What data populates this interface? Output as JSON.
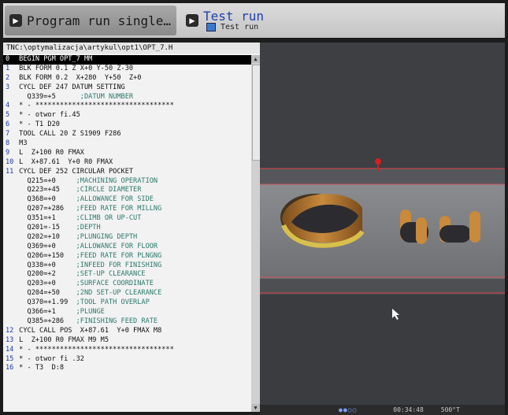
{
  "top_bar": {
    "left_tab_label": "Program run single…",
    "right_tab_title": "Test run",
    "right_tab_subtitle": "Test run"
  },
  "program": {
    "path": "TNC:\\optymalizacja\\artykul\\opt1\\OPT_7.H",
    "lines": [
      {
        "n": "0",
        "text": " BEGIN PGM OPT_7 MM",
        "active": true
      },
      {
        "n": "1",
        "text": " BLK FORM 0.1 Z X+0 Y-50 Z-30"
      },
      {
        "n": "2",
        "text": " BLK FORM 0.2  X+280  Y+50  Z+0"
      },
      {
        "n": "3",
        "text": " CYCL DEF 247 DATUM SETTING"
      },
      {
        "n": "",
        "text": "   Q339=+5      ;DATUM NUMBER"
      },
      {
        "n": "4",
        "text": " * - **********************************"
      },
      {
        "n": "5",
        "text": " * - otwor fi.45"
      },
      {
        "n": "6",
        "text": " * - T1 D20"
      },
      {
        "n": "7",
        "text": " TOOL CALL 20 Z S1909 F286"
      },
      {
        "n": "8",
        "text": " M3"
      },
      {
        "n": "9",
        "text": " L  Z+100 R0 FMAX"
      },
      {
        "n": "10",
        "text": " L  X+87.61  Y+0 R0 FMAX"
      },
      {
        "n": "11",
        "text": " CYCL DEF 252 CIRCULAR POCKET"
      },
      {
        "n": "",
        "text": "   Q215=+0     ;MACHINING OPERATION"
      },
      {
        "n": "",
        "text": "   Q223=+45    ;CIRCLE DIAMETER"
      },
      {
        "n": "",
        "text": "   Q368=+0     ;ALLOWANCE FOR SIDE"
      },
      {
        "n": "",
        "text": "   Q207=+286   ;FEED RATE FOR MILLNG"
      },
      {
        "n": "",
        "text": "   Q351=+1     ;CLIMB OR UP-CUT"
      },
      {
        "n": "",
        "text": "   Q201=-15    ;DEPTH"
      },
      {
        "n": "",
        "text": "   Q202=+10    ;PLUNGING DEPTH"
      },
      {
        "n": "",
        "text": "   Q369=+0     ;ALLOWANCE FOR FLOOR"
      },
      {
        "n": "",
        "text": "   Q206=+150   ;FEED RATE FOR PLNGNG"
      },
      {
        "n": "",
        "text": "   Q338=+0     ;INFEED FOR FINISHING"
      },
      {
        "n": "",
        "text": "   Q200=+2     ;SET-UP CLEARANCE"
      },
      {
        "n": "",
        "text": "   Q203=+0     ;SURFACE COORDINATE"
      },
      {
        "n": "",
        "text": "   Q204=+50    ;2ND SET-UP CLEARANCE"
      },
      {
        "n": "",
        "text": "   Q370=+1.99  ;TOOL PATH OVERLAP"
      },
      {
        "n": "",
        "text": "   Q366=+1     ;PLUNGE"
      },
      {
        "n": "",
        "text": "   Q385=+286   ;FINISHING FEED RATE"
      },
      {
        "n": "12",
        "text": " CYCL CALL POS  X+87.61  Y+0 FMAX M8"
      },
      {
        "n": "13",
        "text": " L  Z+100 R0 FMAX M9 M5"
      },
      {
        "n": "14",
        "text": " * - **********************************"
      },
      {
        "n": "15",
        "text": " * - otwor fi .32"
      },
      {
        "n": "16",
        "text": " * - T3  D:8"
      }
    ]
  },
  "status": {
    "time": "00:34:48",
    "temp": "500°T"
  },
  "colors": {
    "accent_blue": "#2040b0",
    "comment_green": "#2a7a6a",
    "sim_background": "#3a3c40",
    "tool_red": "#d42020",
    "part_orange": "#b5651d"
  }
}
